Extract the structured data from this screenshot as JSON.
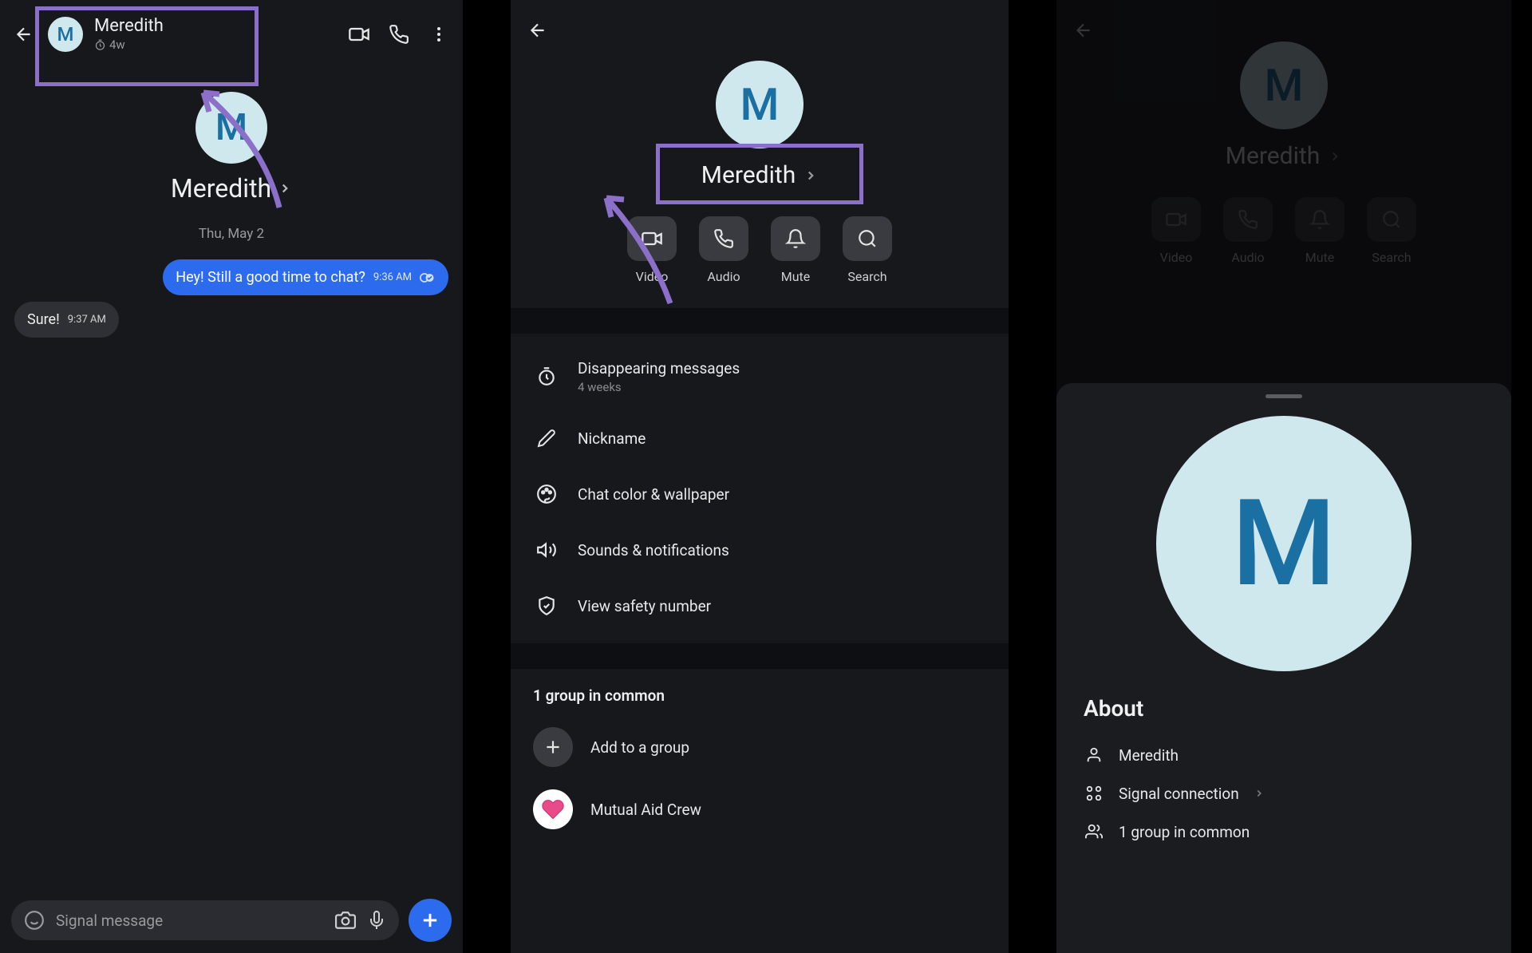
{
  "panel1": {
    "contact_name": "Meredith",
    "timer_value": "4w",
    "avatar_letter": "M",
    "date_separator": "Thu, May 2",
    "messages": [
      {
        "text": "Hey! Still a good time to chat?",
        "time": "9:36 AM",
        "sent": true
      },
      {
        "text": "Sure!",
        "time": "9:37 AM",
        "sent": false
      }
    ],
    "composer_placeholder": "Signal message"
  },
  "panel2": {
    "contact_name": "Meredith",
    "avatar_letter": "M",
    "actions": [
      {
        "label": "Video"
      },
      {
        "label": "Audio"
      },
      {
        "label": "Mute"
      },
      {
        "label": "Search"
      }
    ],
    "settings": [
      {
        "title": "Disappearing messages",
        "sub": "4 weeks",
        "icon": "timer"
      },
      {
        "title": "Nickname",
        "icon": "pencil"
      },
      {
        "title": "Chat color & wallpaper",
        "icon": "palette"
      },
      {
        "title": "Sounds & notifications",
        "icon": "speaker"
      },
      {
        "title": "View safety number",
        "icon": "shield"
      }
    ],
    "groups_header": "1 group in common",
    "add_group_label": "Add to a group",
    "group_name": "Mutual Aid Crew"
  },
  "panel3": {
    "contact_name": "Meredith",
    "avatar_letter": "M",
    "actions": [
      {
        "label": "Video"
      },
      {
        "label": "Audio"
      },
      {
        "label": "Mute"
      },
      {
        "label": "Search"
      }
    ],
    "about_title": "About",
    "about_rows": [
      {
        "text": "Meredith",
        "icon": "person"
      },
      {
        "text": "Signal connection",
        "icon": "connections",
        "chevron": true
      },
      {
        "text": "1 group in common",
        "icon": "groups"
      }
    ]
  }
}
